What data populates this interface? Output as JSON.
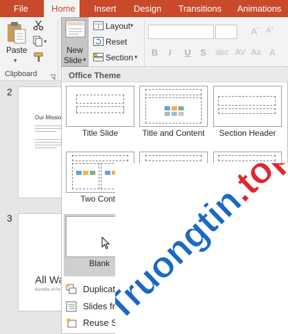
{
  "tabs": [
    "File",
    "Home",
    "Insert",
    "Design",
    "Transitions",
    "Animations"
  ],
  "ribbon": {
    "paste_label": "Paste",
    "new_slide_line1": "New",
    "new_slide_line2": "Slide",
    "layout_label": "Layout",
    "reset_label": "Reset",
    "section_label": "Section",
    "clipboard_group": "Clipboard",
    "format_buttons": [
      "B",
      "I",
      "U",
      "S"
    ]
  },
  "thumbnails": [
    {
      "number": "2",
      "title": "Our Missio"
    },
    {
      "number": "3",
      "title": "All Wa",
      "subtitle": "Benefits of Pe"
    }
  ],
  "dropdown": {
    "header": "Office Theme",
    "layouts": [
      "Title Slide",
      "Title and Content",
      "Section Header",
      "Two Conte",
      "",
      "",
      "Blank"
    ],
    "menu": [
      "Duplicate",
      "Slides fro",
      "Reuse Sli"
    ]
  },
  "watermark": {
    "text": "Truongtin.top"
  },
  "colors": {
    "accent": "#c9492b",
    "watermark_blue": "#1b68c7",
    "watermark_red": "#e2262a"
  }
}
